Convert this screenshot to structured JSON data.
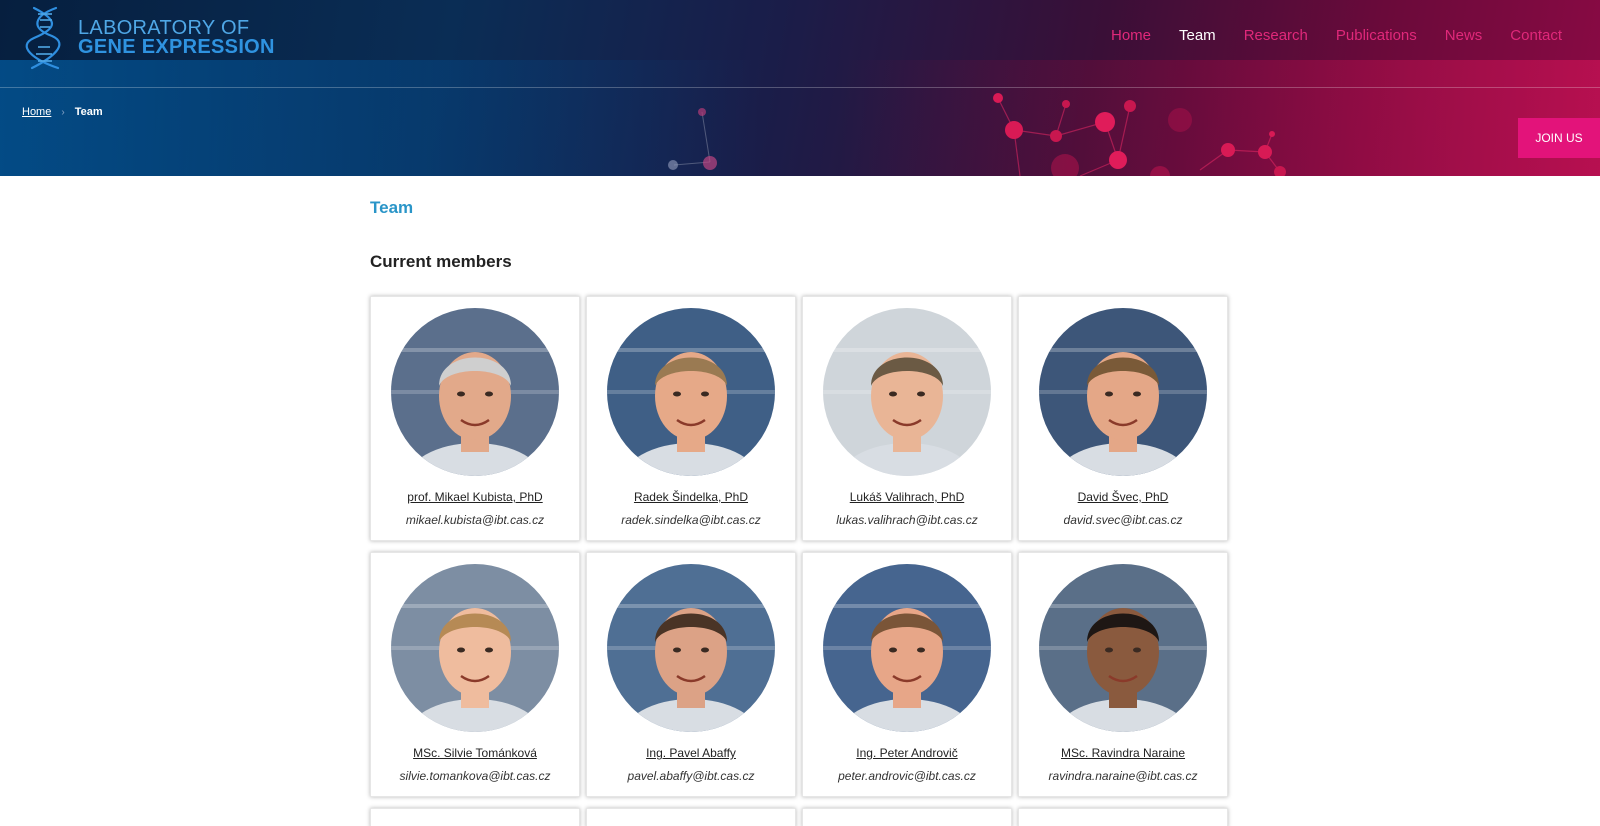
{
  "header": {
    "logo_line1": "LABORATORY OF",
    "logo_line2": "GENE EXPRESSION",
    "nav": [
      {
        "label": "Home",
        "active": false
      },
      {
        "label": "Team",
        "active": true
      },
      {
        "label": "Research",
        "active": false
      },
      {
        "label": "Publications",
        "active": false
      },
      {
        "label": "News",
        "active": false
      },
      {
        "label": "Contact",
        "active": false
      }
    ],
    "join_label": "JOIN US"
  },
  "breadcrumb": {
    "home": "Home",
    "separator": "›",
    "current": "Team"
  },
  "main": {
    "title": "Team",
    "section_title": "Current members",
    "members": [
      {
        "name": "prof. Mikael Kubista, PhD",
        "email": "mikael.kubista@ibt.cas.cz",
        "bg": "#5b6f8c",
        "skin": "#e2a98a",
        "hair": "#cfcfcf"
      },
      {
        "name": "Radek Šindelka, PhD",
        "email": "radek.sindelka@ibt.cas.cz",
        "bg": "#3f5f86",
        "skin": "#e6a988",
        "hair": "#9a7a52"
      },
      {
        "name": "Lukáš Valihrach, PhD",
        "email": "lukas.valihrach@ibt.cas.cz",
        "bg": "#cfd5da",
        "skin": "#e9b596",
        "hair": "#6b5a44"
      },
      {
        "name": "David Švec, PhD",
        "email": "david.svec@ibt.cas.cz",
        "bg": "#3d5679",
        "skin": "#e4a787",
        "hair": "#7a5a38"
      },
      {
        "name": "MSc. Silvie Tománková",
        "email": "silvie.tomankova@ibt.cas.cz",
        "bg": "#7d8ea3",
        "skin": "#efbc9e",
        "hair": "#b68a55"
      },
      {
        "name": "Ing. Pavel Abaffy",
        "email": "pavel.abaffy@ibt.cas.cz",
        "bg": "#4f6f94",
        "skin": "#dca286",
        "hair": "#4a3426"
      },
      {
        "name": "Ing. Peter Androvič",
        "email": "peter.androvic@ibt.cas.cz",
        "bg": "#46658f",
        "skin": "#e7a688",
        "hair": "#7a5538"
      },
      {
        "name": "MSc. Ravindra Naraine",
        "email": "ravindra.naraine@ibt.cas.cz",
        "bg": "#5a6f88",
        "skin": "#8a5a3e",
        "hair": "#1e1714"
      }
    ]
  }
}
